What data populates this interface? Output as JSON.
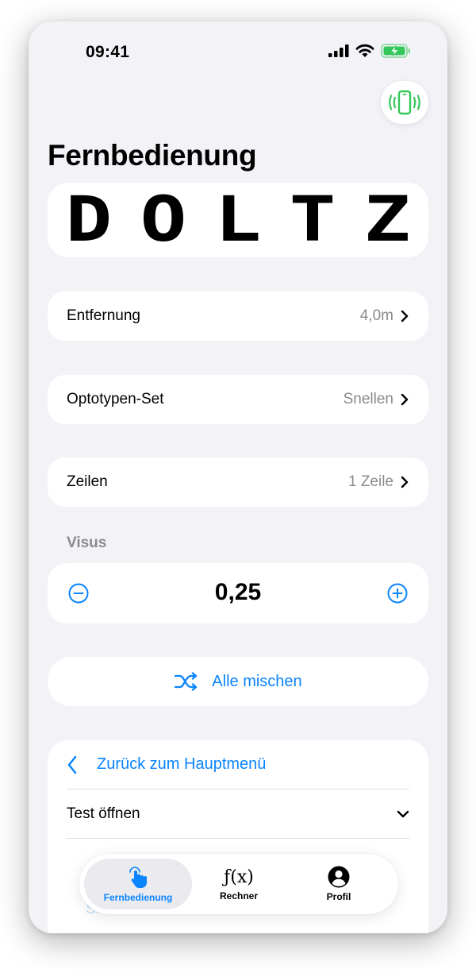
{
  "status": {
    "time": "09:41"
  },
  "header": {
    "title": "Fernbedienung"
  },
  "optotypes": [
    "D",
    "O",
    "L",
    "T",
    "Z"
  ],
  "settings": {
    "distance": {
      "label": "Entfernung",
      "value": "4,0m"
    },
    "optotype_set": {
      "label": "Optotypen-Set",
      "value": "Snellen"
    },
    "lines": {
      "label": "Zeilen",
      "value": "1 Zeile"
    }
  },
  "visus": {
    "section_label": "Visus",
    "value": "0,25"
  },
  "shuffle": {
    "label": "Alle mischen"
  },
  "menu": {
    "back_label": "Zurück zum Hauptmenü",
    "test_label": "Test öffnen",
    "faded_item": "Snellen"
  },
  "tabs": [
    {
      "label": "Fernbedienung",
      "icon": "tap-hand-icon",
      "active": true
    },
    {
      "label": "Rechner",
      "icon": "function-icon",
      "glyph": "ƒ(x)"
    },
    {
      "label": "Profil",
      "icon": "person-circle-icon"
    }
  ],
  "colors": {
    "accent": "#0a84ff",
    "background": "#f2f2f7",
    "battery": "#34c759"
  }
}
